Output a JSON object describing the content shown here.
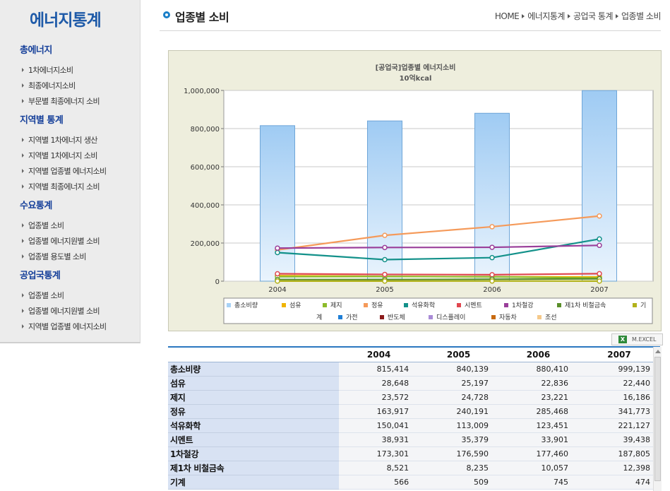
{
  "sidebar": {
    "brand": "에너지통계",
    "sections": [
      {
        "title": "총에너지",
        "items": [
          "1차에너지소비",
          "최종에너지소비",
          "부문별 최종에너지 소비"
        ]
      },
      {
        "title": "지역별 통계",
        "items": [
          "지역별 1차에너지 생산",
          "지역별 1차에너지 소비",
          "지역별 업종별 에너지소비",
          "지역별 최종에너지 소비"
        ]
      },
      {
        "title": "수요통계",
        "items": [
          "업종별 소비",
          "업종별 에너지원별 소비",
          "업종별 용도별 소비"
        ]
      },
      {
        "title": "공업국통계",
        "items": [
          "업종별 소비",
          "업종별 에너지원별 소비",
          "지역별 업종별 에너지소비"
        ]
      }
    ]
  },
  "header": {
    "title": "업종별 소비",
    "breadcrumb": [
      "HOME",
      "에너지통계",
      "공업국 통계",
      "업종별 소비"
    ]
  },
  "excel_button": {
    "label": "M.EXCEL",
    "icon": "excel-icon"
  },
  "colors": {
    "bar_fill_top": "#eaf4fd",
    "bar_fill_bottom": "#9fcbf3",
    "panel_bg": "#eeeedd",
    "plot_bg": "#ffffff",
    "table_header_accent": "#2b78c0",
    "table_label_bg": "#d8e2f3"
  },
  "chart_data": {
    "type": "bar+line",
    "title": "[공업국]업종별 에너지소비",
    "subtitle": "10억kcal",
    "categories": [
      "2004",
      "2005",
      "2006",
      "2007"
    ],
    "ylim": [
      0,
      1000000
    ],
    "yticks": [
      0,
      200000,
      400000,
      600000,
      800000,
      1000000
    ],
    "ytick_labels": [
      "0",
      "200,000",
      "400,000",
      "600,000",
      "800,000",
      "1,000,000"
    ],
    "grid": true,
    "legend_position": "bottom",
    "series": [
      {
        "name": "총소비량",
        "kind": "bar",
        "color": "#a8d2f5",
        "values": [
          815414,
          840139,
          880410,
          999139
        ]
      },
      {
        "name": "섬유",
        "kind": "line",
        "color": "#f0b400",
        "values": [
          28648,
          25197,
          22836,
          22440
        ]
      },
      {
        "name": "제지",
        "kind": "line",
        "color": "#8dbb2a",
        "values": [
          23572,
          24728,
          23221,
          16186
        ]
      },
      {
        "name": "정유",
        "kind": "line",
        "color": "#f59a5a",
        "values": [
          163917,
          240191,
          285468,
          341773
        ]
      },
      {
        "name": "석유화학",
        "kind": "line",
        "color": "#13918a",
        "values": [
          150041,
          113009,
          123451,
          221127
        ]
      },
      {
        "name": "시멘트",
        "kind": "line",
        "color": "#e0474f",
        "values": [
          38931,
          35379,
          33901,
          39438
        ]
      },
      {
        "name": "1차철강",
        "kind": "line",
        "color": "#9a3f9a",
        "values": [
          173301,
          176590,
          177460,
          187805
        ]
      },
      {
        "name": "제1차 비철금속",
        "kind": "line",
        "color": "#5a8f2a",
        "values": [
          8521,
          8235,
          10057,
          12398
        ]
      },
      {
        "name": "기계",
        "kind": "line",
        "color": "#b2b21a",
        "values": [
          566,
          509,
          745,
          474
        ]
      },
      {
        "name": "가전",
        "kind": "line",
        "color": "#1f7fd6",
        "values": [
          null,
          null,
          null,
          null
        ]
      },
      {
        "name": "반도체",
        "kind": "line",
        "color": "#8b1a1a",
        "values": [
          null,
          null,
          null,
          null
        ]
      },
      {
        "name": "디스플레이",
        "kind": "line",
        "color": "#a98bd6",
        "values": [
          null,
          null,
          null,
          null
        ]
      },
      {
        "name": "자동차",
        "kind": "line",
        "color": "#c86a10",
        "values": [
          null,
          null,
          null,
          null
        ]
      },
      {
        "name": "조선",
        "kind": "line",
        "color": "#f5c98a",
        "values": [
          null,
          null,
          null,
          null
        ]
      }
    ]
  },
  "table": {
    "columns": [
      "2004",
      "2005",
      "2006",
      "2007"
    ],
    "rows": [
      {
        "label": "총소비량",
        "values": [
          "815,414",
          "840,139",
          "880,410",
          "999,139"
        ]
      },
      {
        "label": "섬유",
        "values": [
          "28,648",
          "25,197",
          "22,836",
          "22,440"
        ]
      },
      {
        "label": "제지",
        "values": [
          "23,572",
          "24,728",
          "23,221",
          "16,186"
        ]
      },
      {
        "label": "정유",
        "values": [
          "163,917",
          "240,191",
          "285,468",
          "341,773"
        ]
      },
      {
        "label": "석유화학",
        "values": [
          "150,041",
          "113,009",
          "123,451",
          "221,127"
        ]
      },
      {
        "label": "시멘트",
        "values": [
          "38,931",
          "35,379",
          "33,901",
          "39,438"
        ]
      },
      {
        "label": "1차철강",
        "values": [
          "173,301",
          "176,590",
          "177,460",
          "187,805"
        ]
      },
      {
        "label": "제1차 비철금속",
        "values": [
          "8,521",
          "8,235",
          "10,057",
          "12,398"
        ]
      },
      {
        "label": "기계",
        "values": [
          "566",
          "509",
          "745",
          "474"
        ]
      }
    ]
  }
}
